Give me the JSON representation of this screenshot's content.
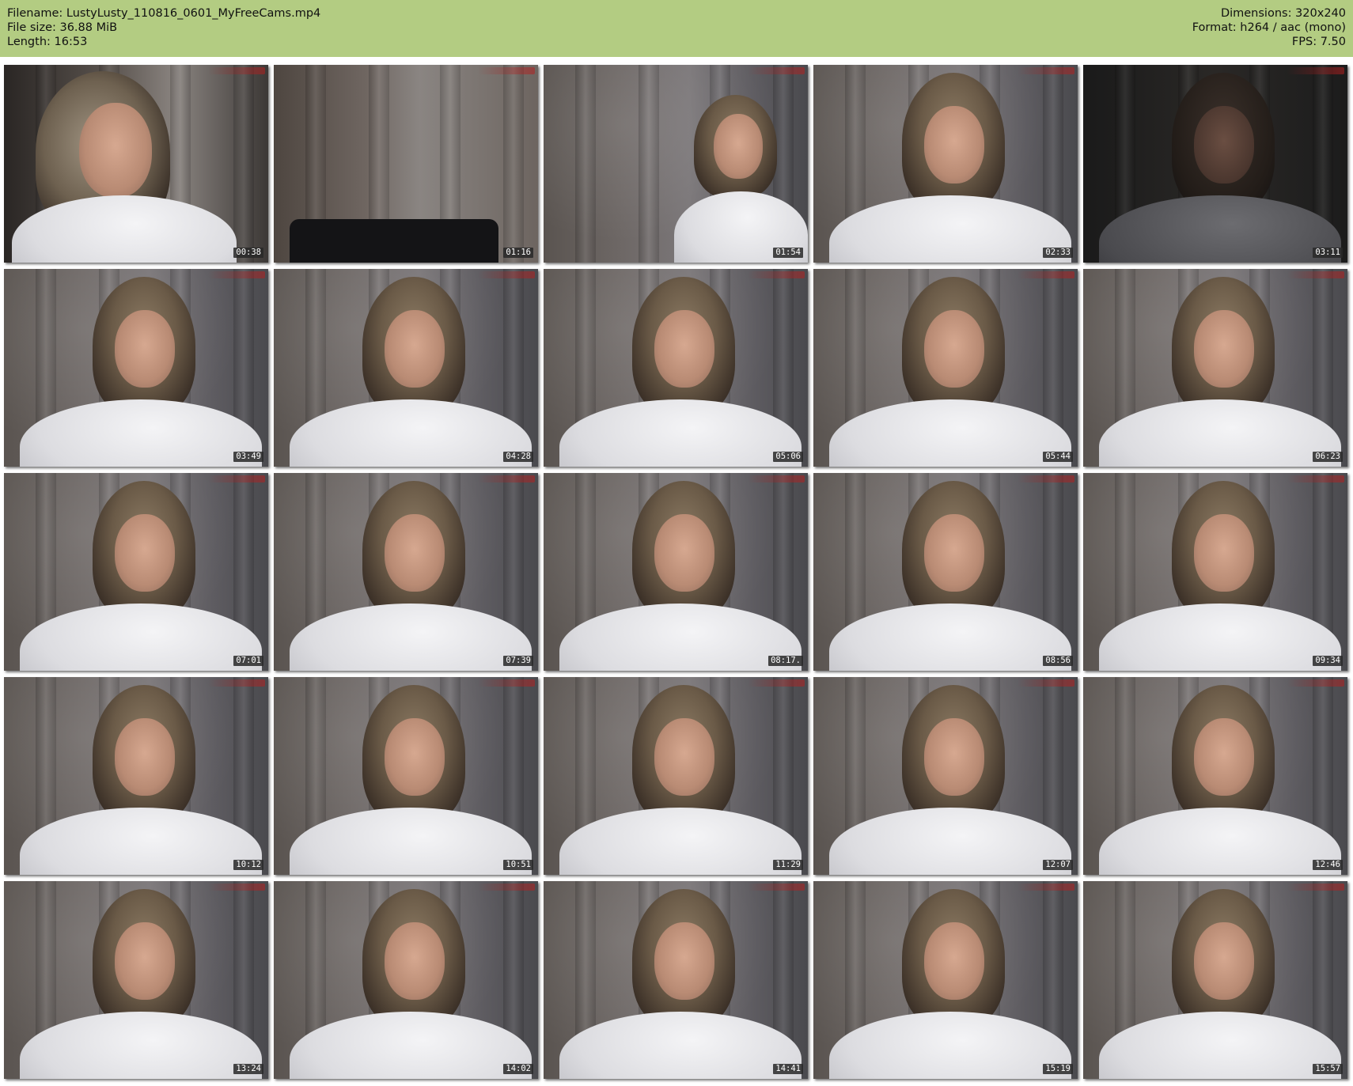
{
  "header": {
    "filename": "Filename: LustyLusty_110816_0601_MyFreeCams.mp4",
    "filesize": "File size: 36.88 MiB",
    "length": "Length: 16:53",
    "dimensions": "Dimensions: 320x240",
    "format": "Format: h264 / aac (mono)",
    "fps": "FPS: 7.50"
  },
  "colors": {
    "header_background": "#b3cc82",
    "timestamp_background": "#282828"
  },
  "thumbnails": [
    {
      "time": "00:38",
      "kind": "first"
    },
    {
      "time": "01:16",
      "kind": "empty"
    },
    {
      "time": "01:54",
      "kind": "side"
    },
    {
      "time": "02:33",
      "kind": "normal"
    },
    {
      "time": "03:11",
      "kind": "dark"
    },
    {
      "time": "03:49",
      "kind": "normal"
    },
    {
      "time": "04:28",
      "kind": "normal"
    },
    {
      "time": "05:06",
      "kind": "normal"
    },
    {
      "time": "05:44",
      "kind": "normal"
    },
    {
      "time": "06:23",
      "kind": "normal"
    },
    {
      "time": "07:01",
      "kind": "normal"
    },
    {
      "time": "07:39",
      "kind": "normal"
    },
    {
      "time": "08:17.",
      "kind": "normal"
    },
    {
      "time": "08:56",
      "kind": "normal"
    },
    {
      "time": "09:34",
      "kind": "normal"
    },
    {
      "time": "10:12",
      "kind": "normal"
    },
    {
      "time": "10:51",
      "kind": "normal"
    },
    {
      "time": "11:29",
      "kind": "normal"
    },
    {
      "time": "12:07",
      "kind": "normal"
    },
    {
      "time": "12:46",
      "kind": "normal"
    },
    {
      "time": "13:24",
      "kind": "normal"
    },
    {
      "time": "14:02",
      "kind": "normal"
    },
    {
      "time": "14:41",
      "kind": "normal"
    },
    {
      "time": "15:19",
      "kind": "normal"
    },
    {
      "time": "15:57",
      "kind": "normal"
    }
  ]
}
